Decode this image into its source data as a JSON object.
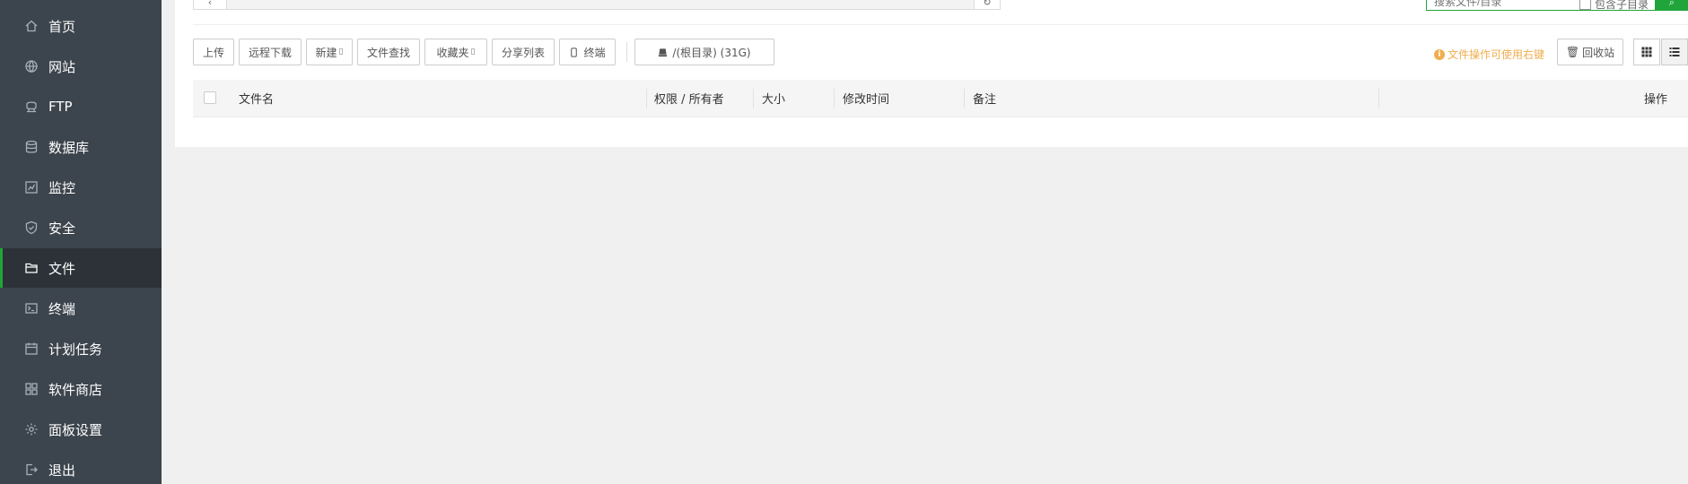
{
  "sidebar": {
    "items": [
      {
        "label": "首页",
        "icon": "home-icon"
      },
      {
        "label": "网站",
        "icon": "globe-icon"
      },
      {
        "label": "FTP",
        "icon": "ftp-icon"
      },
      {
        "label": "数据库",
        "icon": "database-icon"
      },
      {
        "label": "监控",
        "icon": "monitor-icon"
      },
      {
        "label": "安全",
        "icon": "shield-icon"
      },
      {
        "label": "文件",
        "icon": "folder-icon",
        "active": true
      },
      {
        "label": "终端",
        "icon": "terminal-icon"
      },
      {
        "label": "计划任务",
        "icon": "calendar-icon"
      },
      {
        "label": "软件商店",
        "icon": "apps-icon"
      },
      {
        "label": "面板设置",
        "icon": "gear-icon"
      },
      {
        "label": "退出",
        "icon": "logout-icon"
      }
    ]
  },
  "topbar": {
    "search_placeholder": "搜索文件/目录",
    "search_subdir_label": "包含子目录"
  },
  "toolbar": {
    "upload": "上传",
    "remote_download": "远程下载",
    "new": "新建",
    "file_search": "文件查找",
    "favorites": "收藏夹",
    "share_list": "分享列表",
    "terminal": "终端",
    "root_dir": "/(根目录) (31G)",
    "hint": "文件操作可使用右键",
    "recycle_bin": "回收站"
  },
  "table": {
    "columns": [
      "文件名",
      "权限 / 所有者",
      "大小",
      "修改时间",
      "备注",
      "操作"
    ]
  },
  "colors": {
    "sidebar_bg": "#3c444d",
    "sidebar_active_bg": "#2c3238",
    "accent_green": "#20a53a",
    "hint_orange": "#f0ad4e"
  }
}
